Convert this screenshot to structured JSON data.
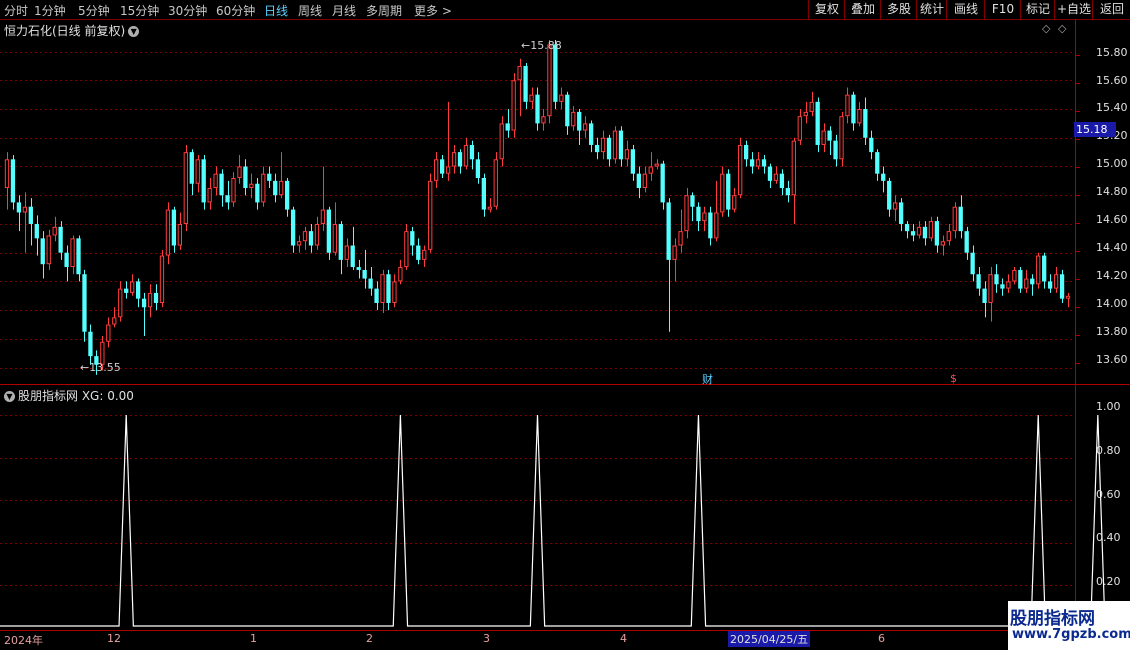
{
  "toolbar": {
    "periods": [
      "分时",
      "1分钟",
      "5分钟",
      "15分钟",
      "30分钟",
      "60分钟",
      "日线",
      "周线",
      "月线",
      "多周期",
      "更多 >"
    ],
    "active_period": "日线",
    "buttons": [
      "复权",
      "叠加",
      "多股",
      "统计",
      "画线",
      "F10",
      "标记",
      "+自选",
      "返回"
    ]
  },
  "chart": {
    "title": "恒力石化(日线 前复权)",
    "dropdown_icon": "chevron-down-icon",
    "high_label": "15.88",
    "low_label": "13.55",
    "current_price": "15.18",
    "marker_cai": "财",
    "marker_dollar": "$",
    "price_axis": [
      "15.80",
      "15.60",
      "15.40",
      "15.20",
      "15.00",
      "14.80",
      "14.60",
      "14.40",
      "14.20",
      "14.00",
      "13.80",
      "13.60"
    ],
    "indicator_title": "股朋指标网 XG: 0.00",
    "indicator_axis": [
      "1.00",
      "0.80",
      "0.60",
      "0.40",
      "0.20"
    ],
    "date_labels": [
      "2024年",
      "12",
      "1",
      "2",
      "3",
      "4",
      "6"
    ],
    "selected_date": "2025/04/25/五",
    "colors": {
      "up": "#ff3c3c",
      "down": "#54ffff",
      "grid": "#800000",
      "signal": "#ffffff"
    }
  },
  "watermark": {
    "title": "股朋指标网",
    "url": "www.7gpzb.com"
  },
  "chart_data": {
    "type": "candlestick",
    "y_range": [
      13.5,
      15.95
    ],
    "candles": [
      {
        "o": 14.85,
        "c": 15.05,
        "h": 15.1,
        "l": 14.7
      },
      {
        "o": 15.05,
        "c": 14.75,
        "h": 15.08,
        "l": 14.7
      },
      {
        "o": 14.75,
        "c": 14.68,
        "h": 14.8,
        "l": 14.55
      },
      {
        "o": 14.68,
        "c": 14.72,
        "h": 14.82,
        "l": 14.4
      },
      {
        "o": 14.72,
        "c": 14.6,
        "h": 14.78,
        "l": 14.45
      },
      {
        "o": 14.6,
        "c": 14.5,
        "h": 14.66,
        "l": 14.38
      },
      {
        "o": 14.5,
        "c": 14.32,
        "h": 14.55,
        "l": 14.22
      },
      {
        "o": 14.32,
        "c": 14.52,
        "h": 14.56,
        "l": 14.28
      },
      {
        "o": 14.52,
        "c": 14.58,
        "h": 14.65,
        "l": 14.48
      },
      {
        "o": 14.58,
        "c": 14.4,
        "h": 14.62,
        "l": 14.35
      },
      {
        "o": 14.4,
        "c": 14.3,
        "h": 14.45,
        "l": 14.2
      },
      {
        "o": 14.3,
        "c": 14.5,
        "h": 14.52,
        "l": 14.25
      },
      {
        "o": 14.5,
        "c": 14.25,
        "h": 14.52,
        "l": 14.2
      },
      {
        "o": 14.25,
        "c": 13.85,
        "h": 14.28,
        "l": 13.78
      },
      {
        "o": 13.85,
        "c": 13.68,
        "h": 13.9,
        "l": 13.62
      },
      {
        "o": 13.68,
        "c": 13.62,
        "h": 13.72,
        "l": 13.55
      },
      {
        "o": 13.62,
        "c": 13.78,
        "h": 13.82,
        "l": 13.58
      },
      {
        "o": 13.78,
        "c": 13.9,
        "h": 13.95,
        "l": 13.74
      },
      {
        "o": 13.9,
        "c": 13.95,
        "h": 14.02,
        "l": 13.88
      },
      {
        "o": 13.95,
        "c": 14.15,
        "h": 14.2,
        "l": 13.92
      },
      {
        "o": 14.15,
        "c": 14.12,
        "h": 14.2,
        "l": 14.08
      },
      {
        "o": 14.12,
        "c": 14.2,
        "h": 14.25,
        "l": 14.1
      },
      {
        "o": 14.2,
        "c": 14.08,
        "h": 14.22,
        "l": 14.02
      },
      {
        "o": 14.08,
        "c": 14.02,
        "h": 14.12,
        "l": 13.82
      },
      {
        "o": 14.02,
        "c": 14.12,
        "h": 14.18,
        "l": 13.95
      },
      {
        "o": 14.12,
        "c": 14.05,
        "h": 14.18,
        "l": 14.0
      },
      {
        "o": 14.05,
        "c": 14.38,
        "h": 14.42,
        "l": 14.02
      },
      {
        "o": 14.38,
        "c": 14.7,
        "h": 14.75,
        "l": 14.32
      },
      {
        "o": 14.7,
        "c": 14.45,
        "h": 14.72,
        "l": 14.4
      },
      {
        "o": 14.45,
        "c": 14.6,
        "h": 14.68,
        "l": 14.42
      },
      {
        "o": 14.6,
        "c": 15.1,
        "h": 15.15,
        "l": 14.55
      },
      {
        "o": 15.1,
        "c": 14.88,
        "h": 15.12,
        "l": 14.8
      },
      {
        "o": 14.88,
        "c": 15.05,
        "h": 15.08,
        "l": 14.82
      },
      {
        "o": 15.05,
        "c": 14.75,
        "h": 15.08,
        "l": 14.7
      },
      {
        "o": 14.75,
        "c": 14.85,
        "h": 14.92,
        "l": 14.7
      },
      {
        "o": 14.85,
        "c": 14.95,
        "h": 15.0,
        "l": 14.8
      },
      {
        "o": 14.95,
        "c": 14.8,
        "h": 14.98,
        "l": 14.72
      },
      {
        "o": 14.8,
        "c": 14.75,
        "h": 14.9,
        "l": 14.7
      },
      {
        "o": 14.75,
        "c": 14.92,
        "h": 14.96,
        "l": 14.72
      },
      {
        "o": 14.92,
        "c": 15.0,
        "h": 15.08,
        "l": 14.88
      },
      {
        "o": 15.0,
        "c": 14.85,
        "h": 15.05,
        "l": 14.8
      },
      {
        "o": 14.85,
        "c": 14.88,
        "h": 14.95,
        "l": 14.78
      },
      {
        "o": 14.88,
        "c": 14.75,
        "h": 14.92,
        "l": 14.7
      },
      {
        "o": 14.75,
        "c": 14.95,
        "h": 15.0,
        "l": 14.72
      },
      {
        "o": 14.95,
        "c": 14.9,
        "h": 15.0,
        "l": 14.85
      },
      {
        "o": 14.9,
        "c": 14.8,
        "h": 14.95,
        "l": 14.75
      },
      {
        "o": 14.8,
        "c": 14.9,
        "h": 15.1,
        "l": 14.78
      },
      {
        "o": 14.9,
        "c": 14.7,
        "h": 14.92,
        "l": 14.65
      },
      {
        "o": 14.7,
        "c": 14.45,
        "h": 14.72,
        "l": 14.4
      },
      {
        "o": 14.45,
        "c": 14.48,
        "h": 14.52,
        "l": 14.4
      },
      {
        "o": 14.48,
        "c": 14.55,
        "h": 14.58,
        "l": 14.42
      },
      {
        "o": 14.55,
        "c": 14.45,
        "h": 14.6,
        "l": 14.4
      },
      {
        "o": 14.45,
        "c": 14.6,
        "h": 14.65,
        "l": 14.42
      },
      {
        "o": 14.6,
        "c": 14.7,
        "h": 15.0,
        "l": 14.55
      },
      {
        "o": 14.7,
        "c": 14.4,
        "h": 14.72,
        "l": 14.35
      },
      {
        "o": 14.4,
        "c": 14.6,
        "h": 14.75,
        "l": 14.38
      },
      {
        "o": 14.6,
        "c": 14.35,
        "h": 14.62,
        "l": 14.25
      },
      {
        "o": 14.35,
        "c": 14.45,
        "h": 14.5,
        "l": 14.3
      },
      {
        "o": 14.45,
        "c": 14.3,
        "h": 14.58,
        "l": 14.28
      },
      {
        "o": 14.3,
        "c": 14.28,
        "h": 14.35,
        "l": 14.22
      },
      {
        "o": 14.28,
        "c": 14.22,
        "h": 14.42,
        "l": 14.15
      },
      {
        "o": 14.22,
        "c": 14.15,
        "h": 14.3,
        "l": 14.1
      },
      {
        "o": 14.15,
        "c": 14.05,
        "h": 14.2,
        "l": 14.0
      },
      {
        "o": 14.05,
        "c": 14.25,
        "h": 14.28,
        "l": 13.98
      },
      {
        "o": 14.25,
        "c": 14.05,
        "h": 14.28,
        "l": 14.0
      },
      {
        "o": 14.05,
        "c": 14.2,
        "h": 14.25,
        "l": 14.02
      },
      {
        "o": 14.2,
        "c": 14.3,
        "h": 14.35,
        "l": 14.18
      },
      {
        "o": 14.3,
        "c": 14.55,
        "h": 14.6,
        "l": 14.28
      },
      {
        "o": 14.55,
        "c": 14.45,
        "h": 14.58,
        "l": 14.38
      },
      {
        "o": 14.45,
        "c": 14.35,
        "h": 14.5,
        "l": 14.32
      },
      {
        "o": 14.35,
        "c": 14.42,
        "h": 14.45,
        "l": 14.3
      },
      {
        "o": 14.42,
        "c": 14.9,
        "h": 14.95,
        "l": 14.4
      },
      {
        "o": 14.9,
        "c": 15.05,
        "h": 15.1,
        "l": 14.85
      },
      {
        "o": 15.05,
        "c": 14.95,
        "h": 15.08,
        "l": 14.92
      },
      {
        "o": 14.95,
        "c": 15.0,
        "h": 15.45,
        "l": 14.9
      },
      {
        "o": 15.0,
        "c": 15.1,
        "h": 15.15,
        "l": 14.95
      },
      {
        "o": 15.1,
        "c": 15.0,
        "h": 15.12,
        "l": 14.95
      },
      {
        "o": 15.0,
        "c": 15.15,
        "h": 15.2,
        "l": 14.98
      },
      {
        "o": 15.15,
        "c": 15.05,
        "h": 15.18,
        "l": 14.98
      },
      {
        "o": 15.05,
        "c": 14.92,
        "h": 15.1,
        "l": 14.88
      },
      {
        "o": 14.92,
        "c": 14.7,
        "h": 14.95,
        "l": 14.65
      },
      {
        "o": 14.7,
        "c": 14.72,
        "h": 14.78,
        "l": 14.68
      },
      {
        "o": 14.72,
        "c": 15.05,
        "h": 15.1,
        "l": 14.7
      },
      {
        "o": 15.05,
        "c": 15.3,
        "h": 15.35,
        "l": 15.0
      },
      {
        "o": 15.3,
        "c": 15.25,
        "h": 15.4,
        "l": 15.2
      },
      {
        "o": 15.25,
        "c": 15.6,
        "h": 15.65,
        "l": 15.2
      },
      {
        "o": 15.6,
        "c": 15.7,
        "h": 15.75,
        "l": 15.35
      },
      {
        "o": 15.7,
        "c": 15.45,
        "h": 15.72,
        "l": 15.4
      },
      {
        "o": 15.45,
        "c": 15.5,
        "h": 15.55,
        "l": 15.4
      },
      {
        "o": 15.5,
        "c": 15.3,
        "h": 15.55,
        "l": 15.25
      },
      {
        "o": 15.3,
        "c": 15.35,
        "h": 15.4,
        "l": 15.25
      },
      {
        "o": 15.35,
        "c": 15.85,
        "h": 15.88,
        "l": 15.3
      },
      {
        "o": 15.85,
        "c": 15.45,
        "h": 15.88,
        "l": 15.4
      },
      {
        "o": 15.45,
        "c": 15.5,
        "h": 15.55,
        "l": 15.4
      },
      {
        "o": 15.5,
        "c": 15.28,
        "h": 15.52,
        "l": 15.22
      },
      {
        "o": 15.28,
        "c": 15.38,
        "h": 15.42,
        "l": 15.25
      },
      {
        "o": 15.38,
        "c": 15.25,
        "h": 15.4,
        "l": 15.15
      },
      {
        "o": 15.25,
        "c": 15.3,
        "h": 15.35,
        "l": 15.2
      },
      {
        "o": 15.3,
        "c": 15.15,
        "h": 15.32,
        "l": 15.1
      },
      {
        "o": 15.15,
        "c": 15.1,
        "h": 15.2,
        "l": 15.05
      },
      {
        "o": 15.1,
        "c": 15.2,
        "h": 15.25,
        "l": 15.05
      },
      {
        "o": 15.2,
        "c": 15.05,
        "h": 15.22,
        "l": 15.0
      },
      {
        "o": 15.05,
        "c": 15.25,
        "h": 15.28,
        "l": 15.02
      },
      {
        "o": 15.25,
        "c": 15.05,
        "h": 15.28,
        "l": 15.0
      },
      {
        "o": 15.05,
        "c": 15.12,
        "h": 15.18,
        "l": 15.0
      },
      {
        "o": 15.12,
        "c": 14.95,
        "h": 15.15,
        "l": 14.9
      },
      {
        "o": 14.95,
        "c": 14.85,
        "h": 15.0,
        "l": 14.78
      },
      {
        "o": 14.85,
        "c": 14.95,
        "h": 15.0,
        "l": 14.82
      },
      {
        "o": 14.95,
        "c": 15.0,
        "h": 15.1,
        "l": 14.9
      },
      {
        "o": 15.0,
        "c": 15.02,
        "h": 15.05,
        "l": 14.98
      },
      {
        "o": 15.02,
        "c": 14.75,
        "h": 15.04,
        "l": 14.7
      },
      {
        "o": 14.75,
        "c": 14.35,
        "h": 14.78,
        "l": 13.85
      },
      {
        "o": 14.35,
        "c": 14.45,
        "h": 14.5,
        "l": 14.2
      },
      {
        "o": 14.45,
        "c": 14.55,
        "h": 14.7,
        "l": 14.4
      },
      {
        "o": 14.55,
        "c": 14.8,
        "h": 14.85,
        "l": 14.5
      },
      {
        "o": 14.8,
        "c": 14.72,
        "h": 14.82,
        "l": 14.62
      },
      {
        "o": 14.72,
        "c": 14.62,
        "h": 14.75,
        "l": 14.55
      },
      {
        "o": 14.62,
        "c": 14.68,
        "h": 14.72,
        "l": 14.55
      },
      {
        "o": 14.68,
        "c": 14.5,
        "h": 14.72,
        "l": 14.45
      },
      {
        "o": 14.5,
        "c": 14.68,
        "h": 14.9,
        "l": 14.48
      },
      {
        "o": 14.68,
        "c": 14.95,
        "h": 15.0,
        "l": 14.65
      },
      {
        "o": 14.95,
        "c": 14.7,
        "h": 14.98,
        "l": 14.65
      },
      {
        "o": 14.7,
        "c": 14.8,
        "h": 14.85,
        "l": 14.68
      },
      {
        "o": 14.8,
        "c": 15.15,
        "h": 15.2,
        "l": 14.78
      },
      {
        "o": 15.15,
        "c": 15.05,
        "h": 15.18,
        "l": 15.0
      },
      {
        "o": 15.05,
        "c": 15.0,
        "h": 15.1,
        "l": 14.95
      },
      {
        "o": 15.0,
        "c": 15.05,
        "h": 15.1,
        "l": 14.98
      },
      {
        "o": 15.05,
        "c": 15.0,
        "h": 15.08,
        "l": 14.95
      },
      {
        "o": 15.0,
        "c": 14.9,
        "h": 15.02,
        "l": 14.85
      },
      {
        "o": 14.9,
        "c": 14.95,
        "h": 15.0,
        "l": 14.88
      },
      {
        "o": 14.95,
        "c": 14.85,
        "h": 14.98,
        "l": 14.8
      },
      {
        "o": 14.85,
        "c": 14.8,
        "h": 14.9,
        "l": 14.75
      },
      {
        "o": 14.8,
        "c": 15.18,
        "h": 15.2,
        "l": 14.6
      },
      {
        "o": 15.18,
        "c": 15.35,
        "h": 15.4,
        "l": 15.15
      },
      {
        "o": 15.35,
        "c": 15.38,
        "h": 15.45,
        "l": 15.3
      },
      {
        "o": 15.38,
        "c": 15.45,
        "h": 15.52,
        "l": 15.35
      },
      {
        "o": 15.45,
        "c": 15.15,
        "h": 15.48,
        "l": 15.1
      },
      {
        "o": 15.15,
        "c": 15.25,
        "h": 15.3,
        "l": 15.1
      },
      {
        "o": 15.25,
        "c": 15.18,
        "h": 15.28,
        "l": 15.08
      },
      {
        "o": 15.18,
        "c": 15.05,
        "h": 15.22,
        "l": 15.0
      },
      {
        "o": 15.05,
        "c": 15.35,
        "h": 15.38,
        "l": 15.0
      },
      {
        "o": 15.35,
        "c": 15.5,
        "h": 15.55,
        "l": 15.3
      },
      {
        "o": 15.5,
        "c": 15.3,
        "h": 15.52,
        "l": 15.25
      },
      {
        "o": 15.3,
        "c": 15.4,
        "h": 15.45,
        "l": 15.28
      },
      {
        "o": 15.4,
        "c": 15.2,
        "h": 15.48,
        "l": 15.15
      },
      {
        "o": 15.2,
        "c": 15.1,
        "h": 15.25,
        "l": 15.05
      },
      {
        "o": 15.1,
        "c": 14.95,
        "h": 15.12,
        "l": 14.9
      },
      {
        "o": 14.95,
        "c": 14.9,
        "h": 15.0,
        "l": 14.82
      },
      {
        "o": 14.9,
        "c": 14.7,
        "h": 14.92,
        "l": 14.65
      },
      {
        "o": 14.7,
        "c": 14.75,
        "h": 14.8,
        "l": 14.62
      },
      {
        "o": 14.75,
        "c": 14.6,
        "h": 14.78,
        "l": 14.55
      },
      {
        "o": 14.6,
        "c": 14.55,
        "h": 14.62,
        "l": 14.5
      },
      {
        "o": 14.55,
        "c": 14.52,
        "h": 14.6,
        "l": 14.48
      },
      {
        "o": 14.52,
        "c": 14.58,
        "h": 14.62,
        "l": 14.5
      },
      {
        "o": 14.58,
        "c": 14.5,
        "h": 14.62,
        "l": 14.45
      },
      {
        "o": 14.5,
        "c": 14.62,
        "h": 14.65,
        "l": 14.48
      },
      {
        "o": 14.62,
        "c": 14.45,
        "h": 14.65,
        "l": 14.4
      },
      {
        "o": 14.45,
        "c": 14.48,
        "h": 14.52,
        "l": 14.38
      },
      {
        "o": 14.48,
        "c": 14.55,
        "h": 14.6,
        "l": 14.45
      },
      {
        "o": 14.55,
        "c": 14.72,
        "h": 14.75,
        "l": 14.5
      },
      {
        "o": 14.72,
        "c": 14.55,
        "h": 14.8,
        "l": 14.5
      },
      {
        "o": 14.55,
        "c": 14.4,
        "h": 14.58,
        "l": 14.35
      },
      {
        "o": 14.4,
        "c": 14.25,
        "h": 14.45,
        "l": 14.2
      },
      {
        "o": 14.25,
        "c": 14.15,
        "h": 14.3,
        "l": 14.1
      },
      {
        "o": 14.15,
        "c": 14.05,
        "h": 14.2,
        "l": 13.95
      },
      {
        "o": 14.05,
        "c": 14.25,
        "h": 14.3,
        "l": 13.92
      },
      {
        "o": 14.25,
        "c": 14.18,
        "h": 14.32,
        "l": 14.12
      },
      {
        "o": 14.18,
        "c": 14.15,
        "h": 14.22,
        "l": 14.1
      },
      {
        "o": 14.15,
        "c": 14.2,
        "h": 14.25,
        "l": 14.12
      },
      {
        "o": 14.2,
        "c": 14.28,
        "h": 14.3,
        "l": 14.18
      },
      {
        "o": 14.28,
        "c": 14.15,
        "h": 14.3,
        "l": 14.12
      },
      {
        "o": 14.15,
        "c": 14.22,
        "h": 14.28,
        "l": 14.12
      },
      {
        "o": 14.22,
        "c": 14.18,
        "h": 14.25,
        "l": 14.1
      },
      {
        "o": 14.18,
        "c": 14.38,
        "h": 14.4,
        "l": 14.15
      },
      {
        "o": 14.38,
        "c": 14.2,
        "h": 14.4,
        "l": 14.15
      },
      {
        "o": 14.2,
        "c": 14.15,
        "h": 14.25,
        "l": 14.12
      },
      {
        "o": 14.15,
        "c": 14.25,
        "h": 14.3,
        "l": 14.12
      },
      {
        "o": 14.25,
        "c": 14.08,
        "h": 14.28,
        "l": 14.05
      },
      {
        "o": 14.08,
        "c": 14.1,
        "h": 14.12,
        "l": 14.02
      }
    ],
    "xg_signal_bars": [
      20,
      66,
      89,
      116,
      173,
      183
    ],
    "xg_range": [
      0,
      1.08
    ]
  }
}
